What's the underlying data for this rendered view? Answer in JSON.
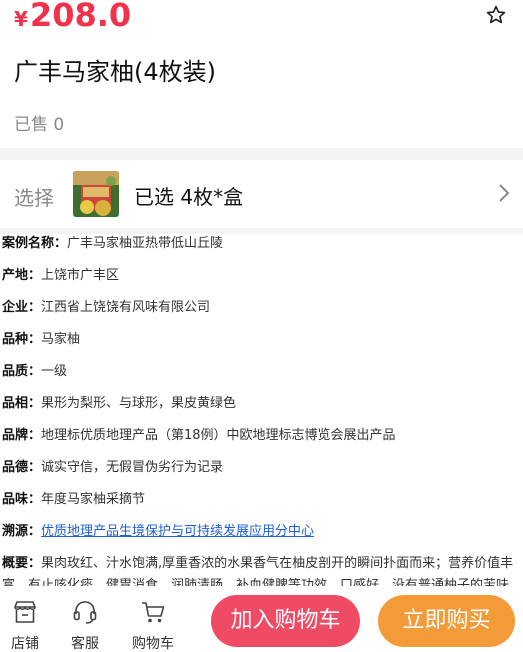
{
  "product": {
    "currency": "¥",
    "price": "208.0",
    "title": "广丰马家柚(4枚装)",
    "sold": "已售 0"
  },
  "sku": {
    "label": "选择",
    "selected": "已选  4枚*盒"
  },
  "details": [
    {
      "key": "案例名称：",
      "value": "广丰马家柚亚热带低山丘陵"
    },
    {
      "key": "产地：",
      "value": "上饶市广丰区"
    },
    {
      "key": "企业：",
      "value": "江西省上饶饶有风味有限公司"
    },
    {
      "key": "品种：",
      "value": "马家柚"
    },
    {
      "key": "品质：",
      "value": "一级"
    },
    {
      "key": "品相：",
      "value": "果形为梨形、与球形，果皮黄绿色"
    },
    {
      "key": "品牌：",
      "value": "地理标优质地理产品（第18例）中欧地理标志博览会展出产品"
    },
    {
      "key": "品德：",
      "value": "诚实守信，无假冒伪劣行为记录"
    },
    {
      "key": "品味：",
      "value": "年度马家柚采摘节"
    },
    {
      "key": "溯源：",
      "value": "优质地理产品生境保护与可持续发展应用分中心"
    },
    {
      "key": "概要：",
      "value": "果肉玫红、汁水饱满,厚重香浓的水果香气在柚皮剖开的瞬间扑面而来；营养价值丰富，有止咳化痰、健胃消食、润肺清肠、补血健脾等功效，口感好，没有普通柚子的苦味"
    }
  ],
  "bottom_bar": {
    "store": "店铺",
    "service": "客服",
    "cart": "购物车",
    "add_to_cart": "加入购物车",
    "buy_now": "立即购买"
  },
  "colors": {
    "price": "#f2314b",
    "add_to_cart": "#f04b64",
    "buy_now": "#f39b38",
    "link": "#1f5fd6"
  },
  "icons": [
    "star-outline-icon",
    "chevron-right-icon",
    "store-icon",
    "headset-icon",
    "cart-icon"
  ]
}
